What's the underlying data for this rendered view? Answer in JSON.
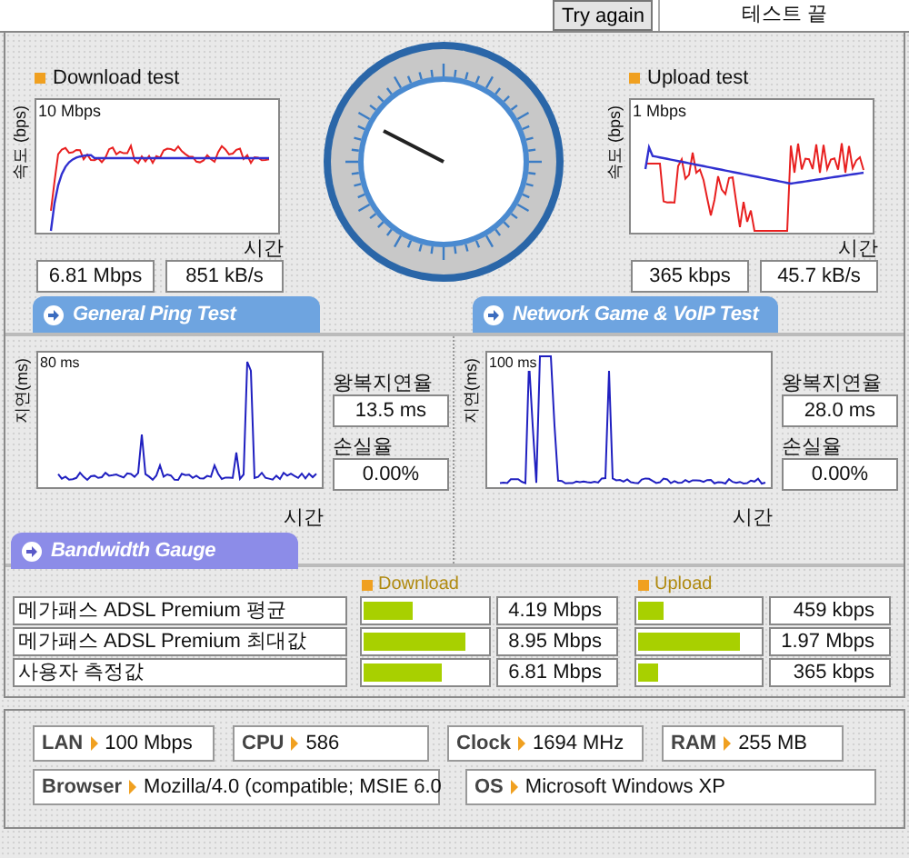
{
  "top_bar": {
    "try_again_button": "Try again",
    "status": "테스트 끝"
  },
  "download_test": {
    "title": "Download test",
    "y_axis_label": "속도 (bps)",
    "scale_label": "10 Mbps",
    "x_axis_label": "시간",
    "speed": "6.81 Mbps",
    "rate": "851 kB/s"
  },
  "upload_test": {
    "title": "Upload test",
    "y_axis_label": "속도 (bps)",
    "scale_label": "1 Mbps",
    "x_axis_label": "시간",
    "speed": "365 kbps",
    "rate": "45.7 kB/s"
  },
  "ping_tests": [
    {
      "heading": "General Ping Test",
      "y_axis_label": "지연(ms)",
      "scale_label": "80 ms",
      "x_axis_label": "시간",
      "latency_label": "왕복지연율",
      "latency": "13.5 ms",
      "loss_label": "손실율",
      "loss": "0.00%"
    },
    {
      "heading": "Network Game & VoIP Test",
      "y_axis_label": "지연(ms)",
      "scale_label": "100 ms",
      "x_axis_label": "시간",
      "latency_label": "왕복지연율",
      "latency": "28.0 ms",
      "loss_label": "손실율",
      "loss": "0.00%"
    }
  ],
  "bandwidth_gauge": {
    "heading": "Bandwidth Gauge",
    "download_header": "Download",
    "upload_header": "Upload",
    "rows": [
      {
        "name": "메가패스 ADSL Premium 평균",
        "download": {
          "level": 0.39,
          "reading": "4.19 Mbps"
        },
        "upload": {
          "level": 0.2,
          "reading": "459 kbps"
        }
      },
      {
        "name": "메가패스 ADSL Premium 최대값",
        "download": {
          "level": 0.81,
          "reading": "8.95 Mbps"
        },
        "upload": {
          "level": 0.82,
          "reading": "1.97 Mbps"
        }
      },
      {
        "name": "사용자 측정값",
        "download": {
          "level": 0.63,
          "reading": "6.81 Mbps"
        },
        "upload": {
          "level": 0.16,
          "reading": "365 kbps"
        }
      }
    ]
  },
  "system_info": {
    "rows": [
      {
        "items": [
          {
            "label": "LAN",
            "value": "100 Mbps"
          },
          {
            "label": "CPU",
            "value": "586"
          },
          {
            "label": "Clock",
            "value": "1694 MHz"
          },
          {
            "label": "RAM",
            "value": "255 MB"
          }
        ]
      },
      {
        "items": [
          {
            "label": "Browser",
            "value": "Mozilla/4.0 (compatible; MSIE 6.0"
          },
          {
            "label": "OS",
            "value": "Microsoft Windows XP"
          }
        ]
      }
    ]
  }
}
